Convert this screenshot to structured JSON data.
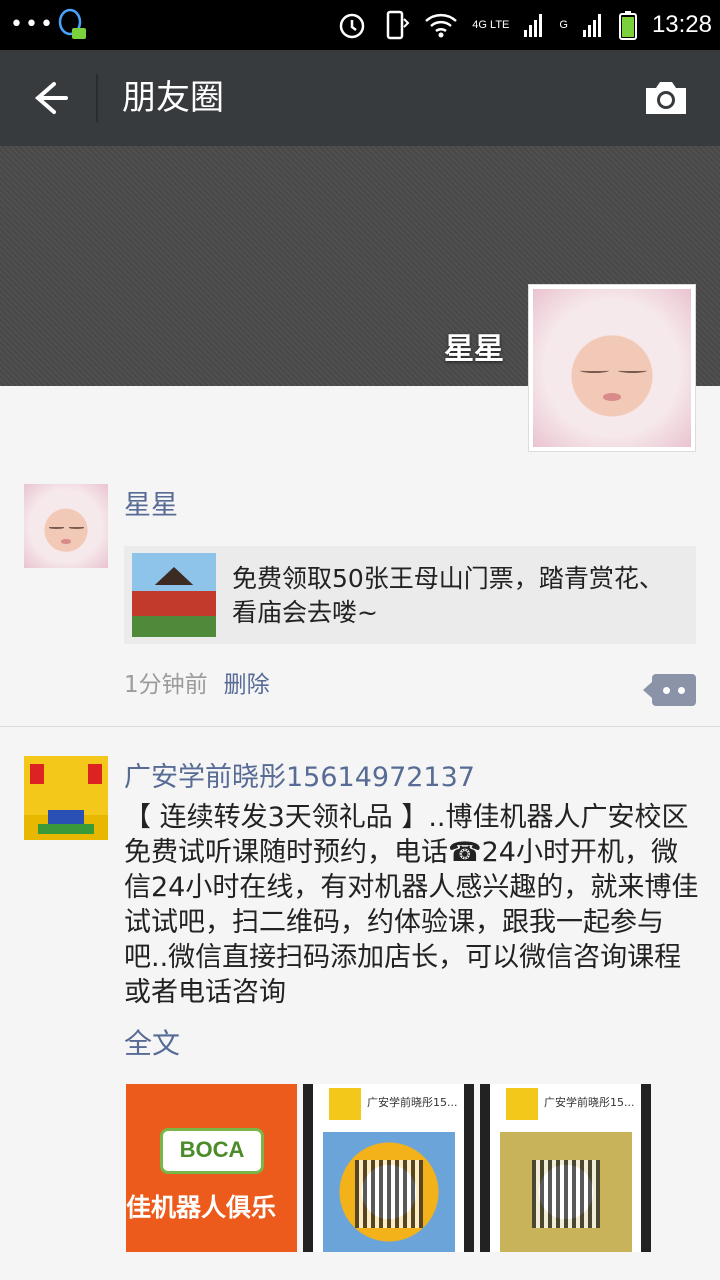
{
  "status_bar": {
    "dots": "•••",
    "network": "4G LTE",
    "network2": "G",
    "time": "13:28"
  },
  "app_bar": {
    "title": "朋友圈"
  },
  "profile": {
    "username": "星星"
  },
  "posts": [
    {
      "author": "星星",
      "shared_link_text": "免费领取50张王母山门票，踏青赏花、看庙会去喽~",
      "time_ago": "1分钟前",
      "delete_label": "删除"
    },
    {
      "author": "广安学前晓彤15614972137",
      "body": "【 连续转发3天领礼品 】..博佳机器人广安校区免费试听课随时预约，电话☎24小时开机，微信24小时在线，有对机器人感兴趣的，就来博佳试试吧，扫二维码，约体验课，跟我一起参与吧..微信直接扫码添加店长，可以微信咨询课程或者电话咨询",
      "full_text_label": "全文",
      "images": [
        {
          "logo_text": "BOCA",
          "banner": "佳机器人俱乐"
        },
        {
          "header": "广安学前晓彤15..."
        },
        {
          "header": "广安学前晓彤15..."
        }
      ]
    }
  ],
  "colors": {
    "link": "#576b95",
    "app_bar": "#373b3e"
  }
}
